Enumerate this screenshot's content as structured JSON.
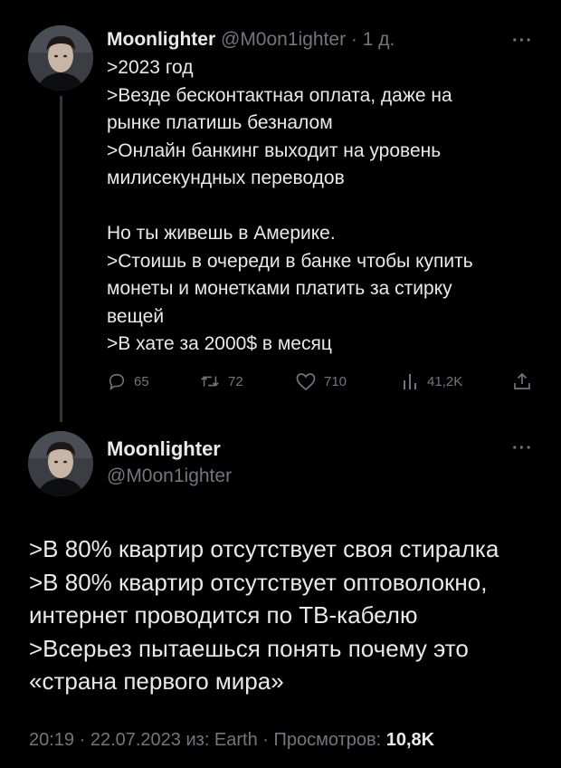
{
  "tweet1": {
    "author_name": "Moonlighter",
    "author_handle": "@M0on1ighter",
    "separator": "·",
    "time_ago": "1 д.",
    "more_label": "···",
    "lines": [
      ">2023 год",
      ">Везде бесконтактная оплата, даже на",
      "рынке платишь безналом",
      ">Онлайн банкинг выходит на уровень",
      "милисекундных переводов",
      "",
      "Но ты живешь в Америке.",
      ">Стоишь в очереди в банке чтобы купить",
      "монеты и монетками платить за стирку",
      "вещей",
      ">В хате за 2000$ в месяц"
    ],
    "actions": {
      "replies": "65",
      "reposts": "72",
      "likes": "710",
      "views": "41,2K"
    },
    "action_icons": [
      "reply-icon",
      "repost-icon",
      "like-icon",
      "views-icon",
      "share-icon"
    ]
  },
  "tweet2": {
    "author_name": "Moonlighter",
    "author_handle": "@M0on1ighter",
    "more_label": "···",
    "lines": [
      ">В 80% квартир отсутствует своя стиралка",
      ">В 80% квартир отсутствует оптоволокно,",
      "интернет проводится по ТВ-кабелю",
      ">Всерьез пытаешься понять почему это",
      "«страна первого мира»"
    ],
    "footer": {
      "meta": "20:19 · 22.07.2023 из: Earth · Просмотров: ",
      "views": "10,8K"
    }
  },
  "colors": {
    "background": "#000000",
    "text": "#e7e9ea",
    "muted": "#71767b",
    "thread_line": "#333639"
  }
}
